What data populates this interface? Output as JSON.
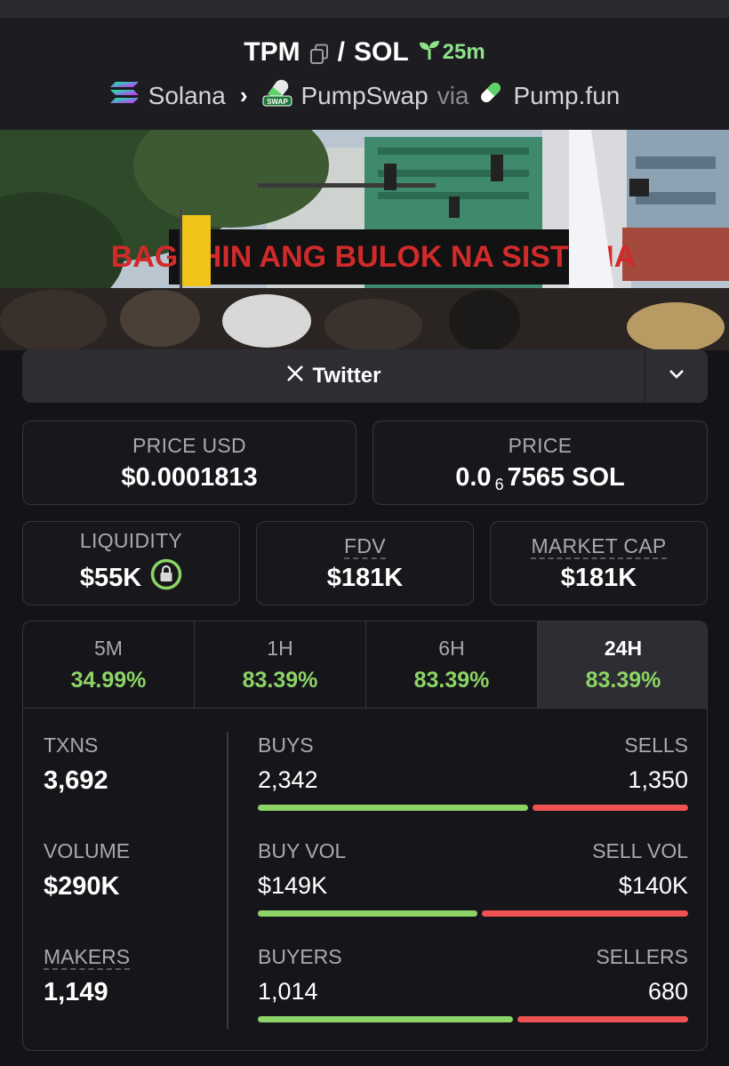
{
  "header": {
    "base_symbol": "TPM",
    "separator": "/",
    "quote_symbol": "SOL",
    "age": "25m",
    "chain": "Solana",
    "dex": "PumpSwap",
    "via_label": "via",
    "launchpad": "Pump.fun",
    "dex_badge": "SWAP"
  },
  "banner": {
    "sign_text": "BAGUHIN ANG BULOK NA SISTEMA"
  },
  "social": {
    "twitter_label": "Twitter"
  },
  "prices": {
    "price_usd_label": "PRICE USD",
    "price_usd_value": "$0.0001813",
    "price_label": "PRICE",
    "price_prefix": "0.0",
    "price_zero_count": "6",
    "price_suffix": "7565 SOL"
  },
  "metrics": {
    "liquidity_label": "LIQUIDITY",
    "liquidity_value": "$55K",
    "fdv_label": "FDV",
    "fdv_value": "$181K",
    "mcap_label": "MARKET CAP",
    "mcap_value": "$181K"
  },
  "timeframes": [
    {
      "label": "5M",
      "change": "34.99%"
    },
    {
      "label": "1H",
      "change": "83.39%"
    },
    {
      "label": "6H",
      "change": "83.39%"
    },
    {
      "label": "24H",
      "change": "83.39%"
    }
  ],
  "stats": {
    "txns_label": "TXNS",
    "txns_value": "3,692",
    "volume_label": "VOLUME",
    "volume_value": "$290K",
    "makers_label": "MAKERS",
    "makers_value": "1,149",
    "buys_label": "BUYS",
    "buys_value": "2,342",
    "sells_label": "SELLS",
    "sells_value": "1,350",
    "buy_fraction": 0.634,
    "buy_vol_label": "BUY VOL",
    "buy_vol_value": "$149K",
    "sell_vol_label": "SELL VOL",
    "sell_vol_value": "$140K",
    "buy_vol_fraction": 0.515,
    "buyers_label": "BUYERS",
    "buyers_value": "1,014",
    "sellers_label": "SELLERS",
    "sellers_value": "680",
    "buyers_fraction": 0.599
  },
  "colors": {
    "positive": "#8cd466",
    "negative": "#ee5252",
    "age_green": "#8fe28a"
  }
}
